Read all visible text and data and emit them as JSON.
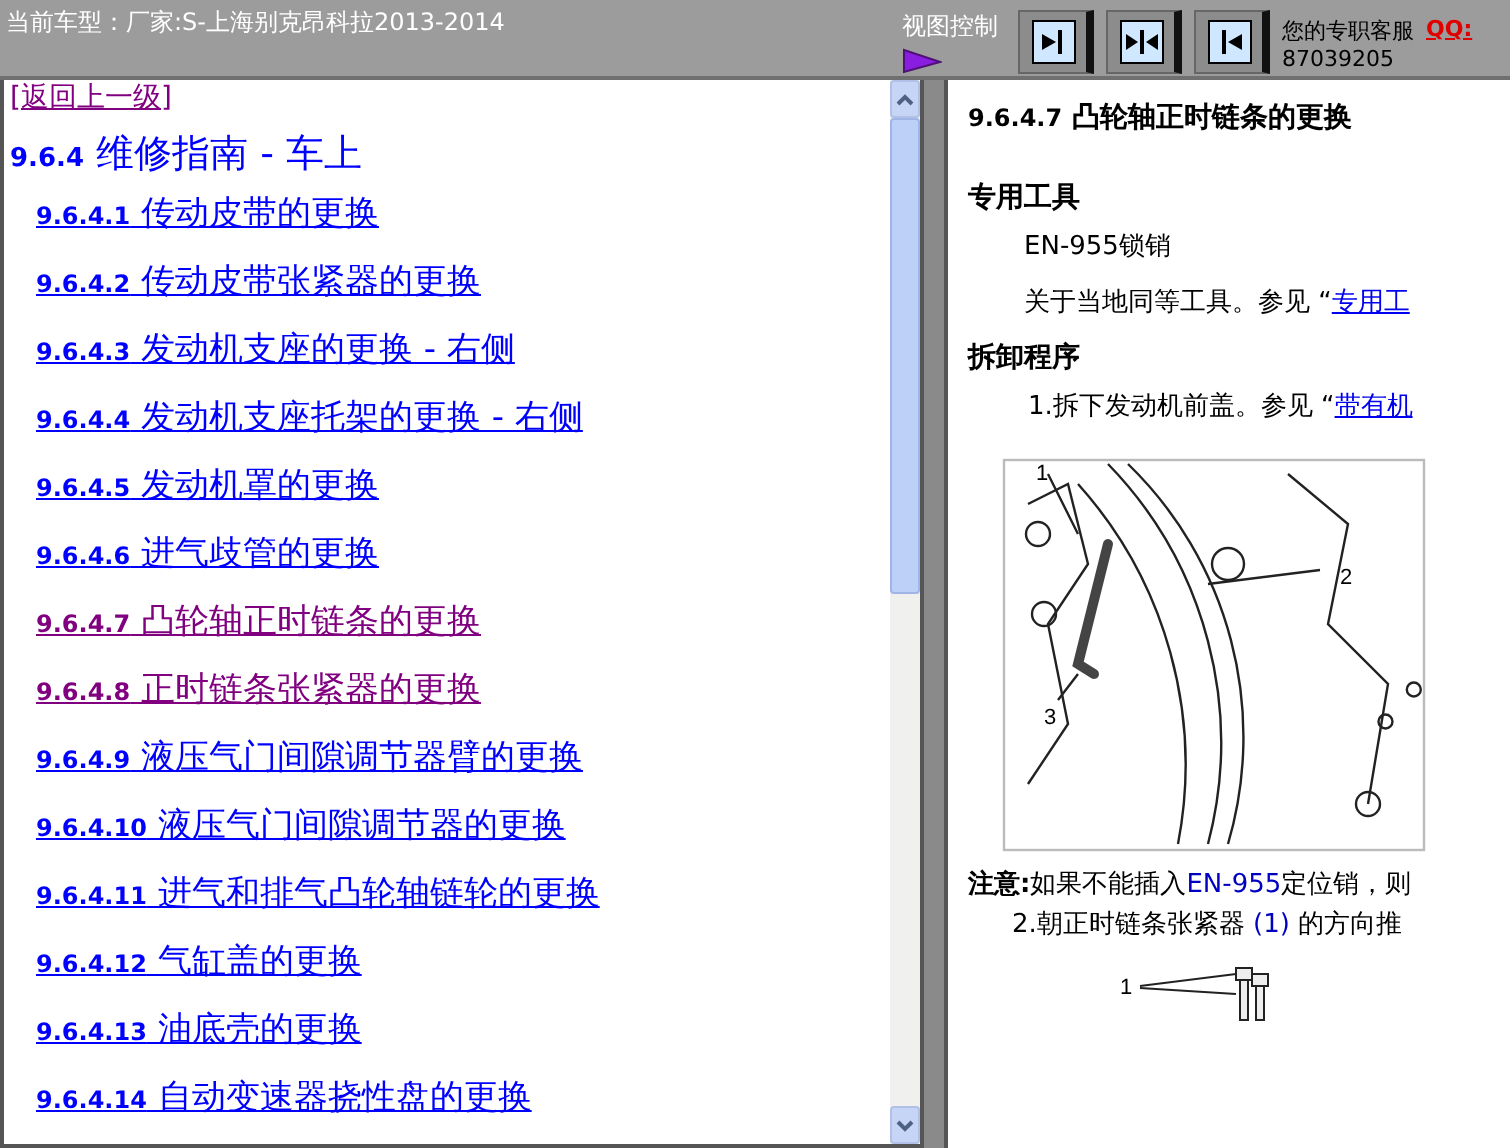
{
  "header": {
    "title": "当前车型：厂家:S-上海别克昂科拉2013-2014",
    "view_control": "视图控制",
    "view_buttons": [
      {
        "kind": "right",
        "selected": false
      },
      {
        "kind": "split",
        "selected": false
      },
      {
        "kind": "left",
        "selected": false
      }
    ],
    "service_label": "您的专职客服",
    "qq_label": "QQ:",
    "qq_number": "87039205"
  },
  "nav": {
    "back_link": {
      "label": "[返回上一级]",
      "visited": true
    },
    "heading": {
      "number": "9.6.4",
      "title": "维修指南 - 车上"
    },
    "items": [
      {
        "number": "9.6.4.1",
        "title": "传动皮带的更换",
        "visited": false
      },
      {
        "number": "9.6.4.2",
        "title": "传动皮带张紧器的更换",
        "visited": false
      },
      {
        "number": "9.6.4.3",
        "title": "发动机支座的更换 - 右侧",
        "visited": false
      },
      {
        "number": "9.6.4.4",
        "title": "发动机支座托架的更换 - 右侧",
        "visited": false
      },
      {
        "number": "9.6.4.5",
        "title": "发动机罩的更换",
        "visited": false
      },
      {
        "number": "9.6.4.6",
        "title": "进气歧管的更换",
        "visited": false
      },
      {
        "number": "9.6.4.7",
        "title": "凸轮轴正时链条的更换",
        "visited": true
      },
      {
        "number": "9.6.4.8",
        "title": "正时链条张紧器的更换",
        "visited": true
      },
      {
        "number": "9.6.4.9",
        "title": "液压气门间隙调节器臂的更换",
        "visited": false
      },
      {
        "number": "9.6.4.10",
        "title": "液压气门间隙调节器的更换",
        "visited": false
      },
      {
        "number": "9.6.4.11",
        "title": "进气和排气凸轮轴链轮的更换",
        "visited": false
      },
      {
        "number": "9.6.4.12",
        "title": "气缸盖的更换",
        "visited": false
      },
      {
        "number": "9.6.4.13",
        "title": "油底壳的更换",
        "visited": false
      },
      {
        "number": "9.6.4.14",
        "title": "自动变速器挠性盘的更换",
        "visited": false
      }
    ]
  },
  "article": {
    "number": "9.6.4.7",
    "title": "凸轮轴正时链条的更换",
    "tools_heading": "专用工具",
    "tool": "EN-955锁销",
    "tools_note": "关于当地同等工具。参见 “",
    "tools_link": "专用工",
    "removal_heading": "拆卸程序",
    "step_1": "1.拆下发动机前盖。参见 “",
    "step_1_link": "带有机",
    "figure_callouts": [
      "1",
      "2",
      "3"
    ],
    "note_label": "注意:",
    "note_text": "如果不能插入",
    "note_code": "EN-955",
    "note_rest": "定位销，则",
    "step_2": "2.朝正时链条张紧器 ",
    "step_2_ref": "(1)",
    "step_2_rest": " 的方向推",
    "figure_2_callout": "1"
  }
}
